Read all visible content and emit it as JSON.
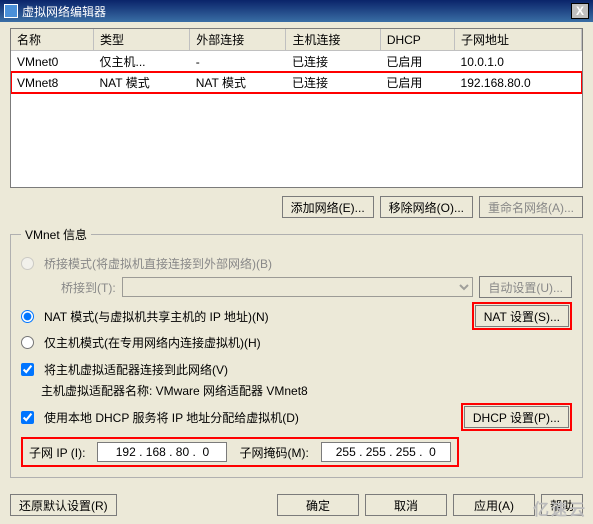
{
  "window": {
    "title": "虚拟网络编辑器",
    "close": "X"
  },
  "table": {
    "headers": [
      "名称",
      "类型",
      "外部连接",
      "主机连接",
      "DHCP",
      "子网地址"
    ],
    "rows": [
      {
        "name": "VMnet0",
        "type": "仅主机...",
        "ext": "-",
        "host": "已连接",
        "dhcp": "已启用",
        "subnet": "10.0.1.0"
      },
      {
        "name": "VMnet8",
        "type": "NAT 模式",
        "ext": "NAT 模式",
        "host": "已连接",
        "dhcp": "已启用",
        "subnet": "192.168.80.0"
      }
    ]
  },
  "netbtns": {
    "add": "添加网络(E)...",
    "remove": "移除网络(O)...",
    "rename": "重命名网络(A)..."
  },
  "group": {
    "legend": "VMnet 信息",
    "bridge": "桥接模式(将虚拟机直接连接到外部网络)(B)",
    "bridge_to": "桥接到(T):",
    "auto": "自动设置(U)...",
    "nat": "NAT 模式(与虚拟机共享主机的 IP 地址)(N)",
    "nat_btn": "NAT 设置(S)...",
    "hostonly": "仅主机模式(在专用网络内连接虚拟机)(H)",
    "connect_host": "将主机虚拟适配器连接到此网络(V)",
    "adapter_label": "主机虚拟适配器名称: VMware 网络适配器 VMnet8",
    "use_dhcp": "使用本地 DHCP 服务将 IP 地址分配给虚拟机(D)",
    "dhcp_btn": "DHCP 设置(P)...",
    "subnet_ip_lbl": "子网 IP (I):",
    "subnet_ip": "192 . 168 . 80 .  0",
    "mask_lbl": "子网掩码(M):",
    "mask": "255 . 255 . 255 .  0"
  },
  "bottom": {
    "restore": "还原默认设置(R)",
    "ok": "确定",
    "cancel": "取消",
    "apply": "应用(A)",
    "help": "帮助"
  },
  "watermark": "亿速云"
}
